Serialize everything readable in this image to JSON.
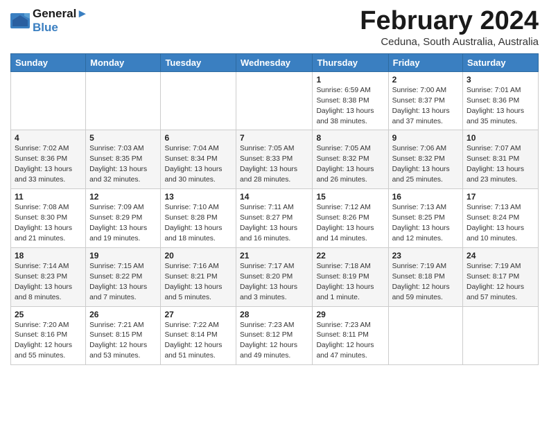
{
  "header": {
    "logo_line1": "General",
    "logo_line2": "Blue",
    "month": "February 2024",
    "location": "Ceduna, South Australia, Australia"
  },
  "weekdays": [
    "Sunday",
    "Monday",
    "Tuesday",
    "Wednesday",
    "Thursday",
    "Friday",
    "Saturday"
  ],
  "weeks": [
    [
      {
        "day": "",
        "info": ""
      },
      {
        "day": "",
        "info": ""
      },
      {
        "day": "",
        "info": ""
      },
      {
        "day": "",
        "info": ""
      },
      {
        "day": "1",
        "info": "Sunrise: 6:59 AM\nSunset: 8:38 PM\nDaylight: 13 hours\nand 38 minutes."
      },
      {
        "day": "2",
        "info": "Sunrise: 7:00 AM\nSunset: 8:37 PM\nDaylight: 13 hours\nand 37 minutes."
      },
      {
        "day": "3",
        "info": "Sunrise: 7:01 AM\nSunset: 8:36 PM\nDaylight: 13 hours\nand 35 minutes."
      }
    ],
    [
      {
        "day": "4",
        "info": "Sunrise: 7:02 AM\nSunset: 8:36 PM\nDaylight: 13 hours\nand 33 minutes."
      },
      {
        "day": "5",
        "info": "Sunrise: 7:03 AM\nSunset: 8:35 PM\nDaylight: 13 hours\nand 32 minutes."
      },
      {
        "day": "6",
        "info": "Sunrise: 7:04 AM\nSunset: 8:34 PM\nDaylight: 13 hours\nand 30 minutes."
      },
      {
        "day": "7",
        "info": "Sunrise: 7:05 AM\nSunset: 8:33 PM\nDaylight: 13 hours\nand 28 minutes."
      },
      {
        "day": "8",
        "info": "Sunrise: 7:05 AM\nSunset: 8:32 PM\nDaylight: 13 hours\nand 26 minutes."
      },
      {
        "day": "9",
        "info": "Sunrise: 7:06 AM\nSunset: 8:32 PM\nDaylight: 13 hours\nand 25 minutes."
      },
      {
        "day": "10",
        "info": "Sunrise: 7:07 AM\nSunset: 8:31 PM\nDaylight: 13 hours\nand 23 minutes."
      }
    ],
    [
      {
        "day": "11",
        "info": "Sunrise: 7:08 AM\nSunset: 8:30 PM\nDaylight: 13 hours\nand 21 minutes."
      },
      {
        "day": "12",
        "info": "Sunrise: 7:09 AM\nSunset: 8:29 PM\nDaylight: 13 hours\nand 19 minutes."
      },
      {
        "day": "13",
        "info": "Sunrise: 7:10 AM\nSunset: 8:28 PM\nDaylight: 13 hours\nand 18 minutes."
      },
      {
        "day": "14",
        "info": "Sunrise: 7:11 AM\nSunset: 8:27 PM\nDaylight: 13 hours\nand 16 minutes."
      },
      {
        "day": "15",
        "info": "Sunrise: 7:12 AM\nSunset: 8:26 PM\nDaylight: 13 hours\nand 14 minutes."
      },
      {
        "day": "16",
        "info": "Sunrise: 7:13 AM\nSunset: 8:25 PM\nDaylight: 13 hours\nand 12 minutes."
      },
      {
        "day": "17",
        "info": "Sunrise: 7:13 AM\nSunset: 8:24 PM\nDaylight: 13 hours\nand 10 minutes."
      }
    ],
    [
      {
        "day": "18",
        "info": "Sunrise: 7:14 AM\nSunset: 8:23 PM\nDaylight: 13 hours\nand 8 minutes."
      },
      {
        "day": "19",
        "info": "Sunrise: 7:15 AM\nSunset: 8:22 PM\nDaylight: 13 hours\nand 7 minutes."
      },
      {
        "day": "20",
        "info": "Sunrise: 7:16 AM\nSunset: 8:21 PM\nDaylight: 13 hours\nand 5 minutes."
      },
      {
        "day": "21",
        "info": "Sunrise: 7:17 AM\nSunset: 8:20 PM\nDaylight: 13 hours\nand 3 minutes."
      },
      {
        "day": "22",
        "info": "Sunrise: 7:18 AM\nSunset: 8:19 PM\nDaylight: 13 hours\nand 1 minute."
      },
      {
        "day": "23",
        "info": "Sunrise: 7:19 AM\nSunset: 8:18 PM\nDaylight: 12 hours\nand 59 minutes."
      },
      {
        "day": "24",
        "info": "Sunrise: 7:19 AM\nSunset: 8:17 PM\nDaylight: 12 hours\nand 57 minutes."
      }
    ],
    [
      {
        "day": "25",
        "info": "Sunrise: 7:20 AM\nSunset: 8:16 PM\nDaylight: 12 hours\nand 55 minutes."
      },
      {
        "day": "26",
        "info": "Sunrise: 7:21 AM\nSunset: 8:15 PM\nDaylight: 12 hours\nand 53 minutes."
      },
      {
        "day": "27",
        "info": "Sunrise: 7:22 AM\nSunset: 8:14 PM\nDaylight: 12 hours\nand 51 minutes."
      },
      {
        "day": "28",
        "info": "Sunrise: 7:23 AM\nSunset: 8:12 PM\nDaylight: 12 hours\nand 49 minutes."
      },
      {
        "day": "29",
        "info": "Sunrise: 7:23 AM\nSunset: 8:11 PM\nDaylight: 12 hours\nand 47 minutes."
      },
      {
        "day": "",
        "info": ""
      },
      {
        "day": "",
        "info": ""
      }
    ]
  ]
}
